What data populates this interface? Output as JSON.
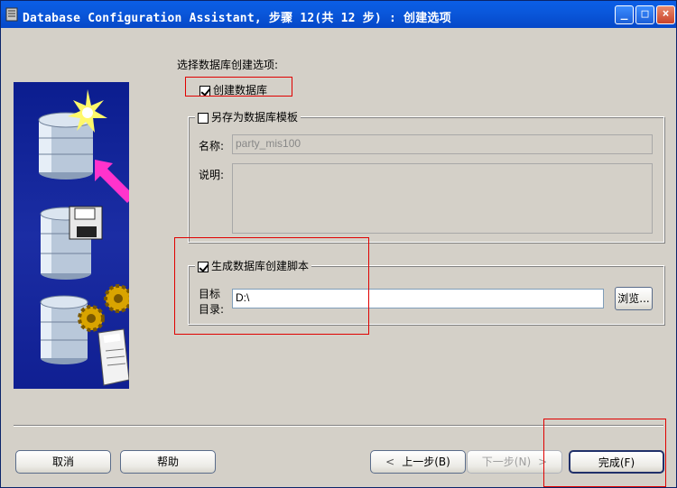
{
  "window": {
    "title": "Database Configuration Assistant, 步骤 12(共 12 步) : 创建选项",
    "minimize": "_",
    "maximize": "□",
    "close": "×"
  },
  "main": {
    "section_label": "选择数据库创建选项:",
    "create_db": {
      "label": "创建数据库",
      "checked": true
    },
    "save_template": {
      "label": "另存为数据库模板",
      "checked": false,
      "name_label": "名称:",
      "name_value": "party_mis100",
      "desc_label": "说明:"
    },
    "gen_script": {
      "label": "生成数据库创建脚本",
      "checked": true,
      "dest_label_1": "目标",
      "dest_label_2": "目录:",
      "dest_value": "D:\\",
      "browse_label": "浏览..."
    }
  },
  "footer": {
    "cancel": "取消",
    "help": "帮助",
    "back": "上一步(B)",
    "next": "下一步(N)",
    "finish": "完成(F)"
  },
  "colors": {
    "title_bar": "#0a58dc",
    "annotation": "#e00000",
    "panel": "#1b2da4"
  }
}
